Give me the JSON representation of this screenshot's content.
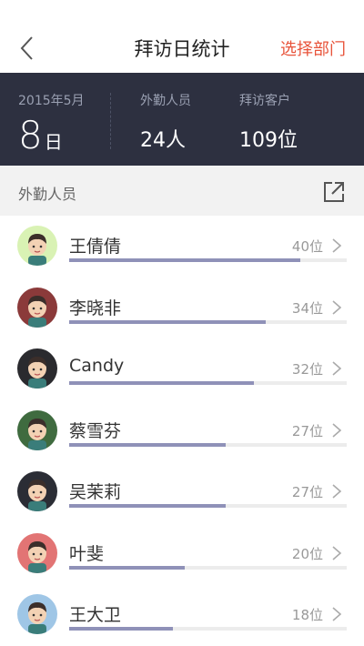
{
  "nav": {
    "title": "拜访日统计",
    "action_label": "选择部门",
    "back_icon": "chevron-left-icon"
  },
  "summary": {
    "month_label": "2015年5月",
    "day_number": "8",
    "day_unit": "日",
    "staff_label": "外勤人员",
    "staff_value": "24人",
    "clients_label": "拜访客户",
    "clients_value": "109位"
  },
  "section": {
    "title": "外勤人员",
    "share_icon": "export-icon"
  },
  "colors": {
    "accent": "#e8533a",
    "summary_bg": "#2d3040",
    "bar_fill": "#8f91b8",
    "bar_track": "#ececec"
  },
  "people": [
    {
      "name": "王倩倩",
      "count": "40位",
      "value": 40,
      "avatar_bg": "#d9f2b4"
    },
    {
      "name": "李晓非",
      "count": "34位",
      "value": 34,
      "avatar_bg": "#8b3a3a"
    },
    {
      "name": "Candy",
      "count": "32位",
      "value": 32,
      "avatar_bg": "#2a2a2e"
    },
    {
      "name": "蔡雪芬",
      "count": "27位",
      "value": 27,
      "avatar_bg": "#3f6b3f"
    },
    {
      "name": "吴茉莉",
      "count": "27位",
      "value": 27,
      "avatar_bg": "#2b2d35"
    },
    {
      "name": "叶斐",
      "count": "20位",
      "value": 20,
      "avatar_bg": "#e27474"
    },
    {
      "name": "王大卫",
      "count": "18位",
      "value": 18,
      "avatar_bg": "#9fc6e6"
    }
  ],
  "bar_max": 48
}
